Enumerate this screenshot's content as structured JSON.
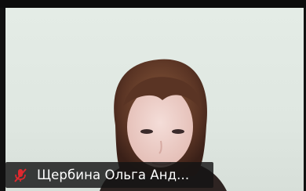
{
  "participant": {
    "display_name": "Щербина Ольга Анд...",
    "mic_state": "muted",
    "mic_icon": "mic-muted-icon"
  },
  "colors": {
    "mute_red": "#e0282e",
    "label_background": "#141414",
    "video_background": "#e2eae4"
  }
}
